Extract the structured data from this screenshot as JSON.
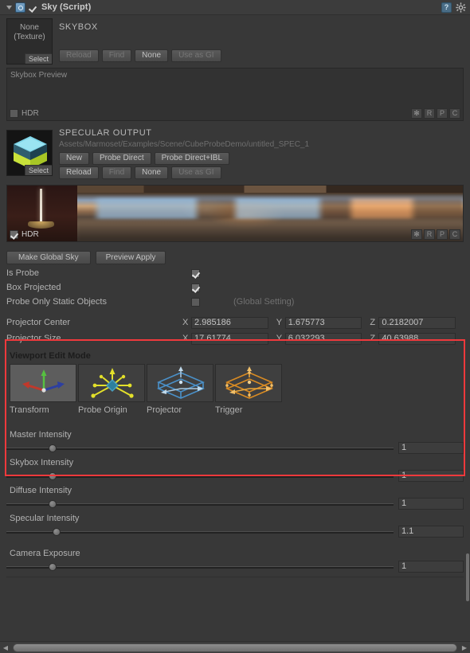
{
  "header": {
    "title": "Sky (Script)",
    "enabled": true,
    "script_icon": "script-icon",
    "help_label": "?",
    "gear": "gear-icon"
  },
  "skybox_slot": {
    "title": "SKYBOX",
    "thumb_none_line1": "None",
    "thumb_none_line2": "(Texture)",
    "select_label": "Select",
    "buttons": [
      "Reload",
      "Find",
      "None",
      "Use as GI"
    ]
  },
  "skybox_preview": {
    "label": "Skybox Preview",
    "hdr_label": "HDR",
    "hdr_checked": false,
    "mode_buttons": [
      "✻",
      "R",
      "P",
      "C"
    ]
  },
  "specular_slot": {
    "title": "SPECULAR OUTPUT",
    "path": "Assets/Marmoset/Examples/Scene/CubeProbeDemo/untitled_SPEC_1",
    "select_label": "Select",
    "buttons_row1": [
      "New",
      "Probe Direct",
      "Probe Direct+IBL"
    ],
    "buttons_row2": [
      "Reload",
      "Find",
      "None",
      "Use as GI"
    ]
  },
  "specular_preview": {
    "hdr_label": "HDR",
    "hdr_checked": true,
    "mode_buttons": [
      "✻",
      "R",
      "P",
      "C"
    ]
  },
  "global_buttons": [
    "Make Global Sky",
    "Preview Apply"
  ],
  "toggles": [
    {
      "label": "Is Probe",
      "checked": true,
      "note": ""
    },
    {
      "label": "Box Projected",
      "checked": true,
      "note": ""
    },
    {
      "label": "Probe Only Static Objects",
      "checked": false,
      "note": "(Global Setting)"
    }
  ],
  "vectors": [
    {
      "label": "Projector Center",
      "fields": [
        {
          "axis": "X",
          "value": "2.985186"
        },
        {
          "axis": "Y",
          "value": "1.675773"
        },
        {
          "axis": "Z",
          "value": "0.2182007"
        }
      ]
    },
    {
      "label": "Projector Size",
      "fields": [
        {
          "axis": "X",
          "value": "17.61774"
        },
        {
          "axis": "Y",
          "value": "6.032293"
        },
        {
          "axis": "Z",
          "value": "40.63988"
        }
      ]
    }
  ],
  "viewport_edit_mode": {
    "title": "Viewport Edit Mode",
    "items": [
      {
        "label": "Transform",
        "icon": "transform-gizmo-icon",
        "active": true
      },
      {
        "label": "Probe Origin",
        "icon": "probe-origin-gizmo-icon",
        "active": false
      },
      {
        "label": "Projector",
        "icon": "projector-box-gizmo-icon",
        "active": false
      },
      {
        "label": "Trigger",
        "icon": "trigger-box-gizmo-icon",
        "active": false
      }
    ]
  },
  "sliders": [
    {
      "label": "Master Intensity",
      "value": "1",
      "knob_pct": 11
    },
    {
      "label": "Skybox Intensity",
      "value": "1",
      "knob_pct": 11
    },
    {
      "label": "Diffuse Intensity",
      "value": "1",
      "knob_pct": 11
    },
    {
      "label": "Specular Intensity",
      "value": "1.1",
      "knob_pct": 12
    },
    {
      "label": "Camera Exposure",
      "value": "1",
      "knob_pct": 11
    }
  ],
  "highlight_color": "#f0393c",
  "scrollbars": {
    "left_arrow": "◀",
    "right_arrow": "▶"
  }
}
